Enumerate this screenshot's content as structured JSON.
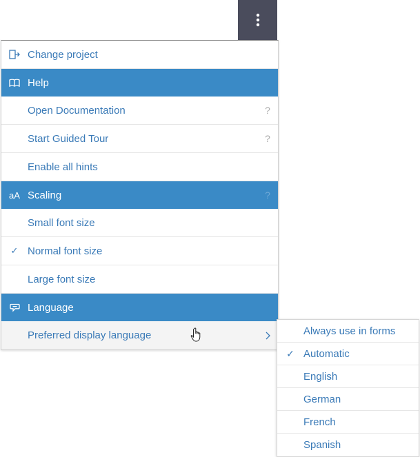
{
  "menu": {
    "change_project": "Change project",
    "help_header": "Help",
    "open_docs": "Open Documentation",
    "guided_tour": "Start Guided Tour",
    "enable_hints": "Enable all hints",
    "scaling_header": "Scaling",
    "small_font": "Small font size",
    "normal_font": "Normal font size",
    "large_font": "Large font size",
    "language_header": "Language",
    "preferred_language": "Preferred display language",
    "hint_mark": "?",
    "check_mark": "✓",
    "scaling_icon_text": "aA"
  },
  "language_submenu": {
    "items": [
      "Always use in forms",
      "Automatic",
      "English",
      "German",
      "French",
      "Spanish"
    ],
    "selected": "Automatic"
  },
  "colors": {
    "header_bg": "#3a8ac6",
    "link": "#3a7ab7",
    "kebab_bg": "#4a4c5c"
  }
}
